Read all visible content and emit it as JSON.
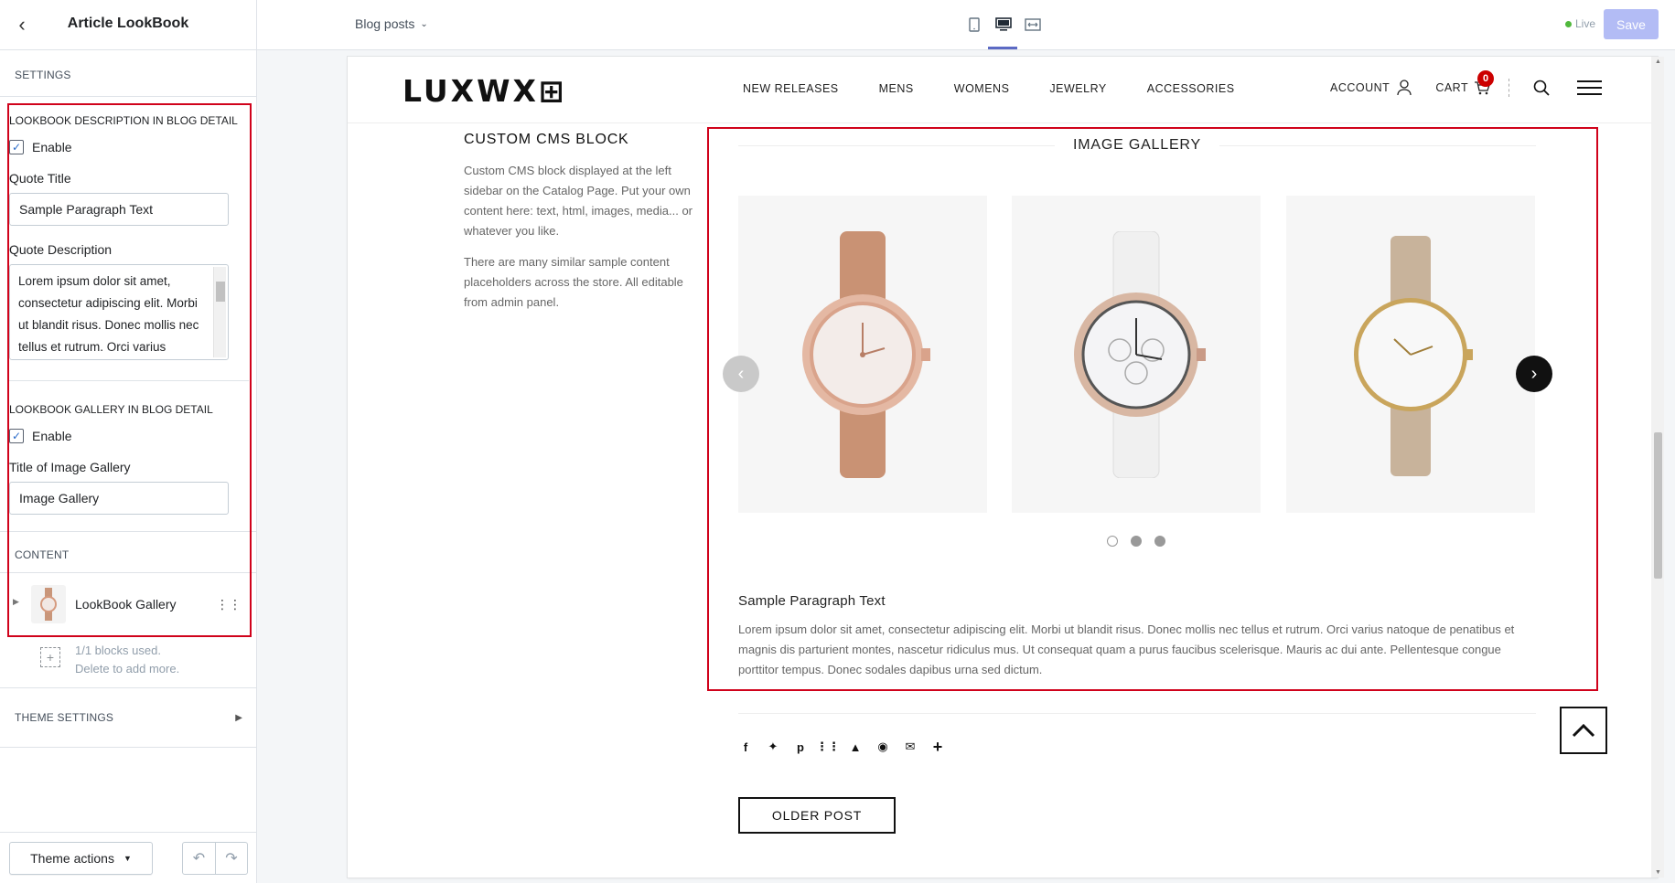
{
  "sidebar": {
    "title": "Article LookBook",
    "settings_label": "SETTINGS",
    "description_group": {
      "title": "LOOKBOOK DESCRIPTION IN BLOG DETAIL",
      "enable_label": "Enable",
      "quote_title_label": "Quote Title",
      "quote_title_value": "Sample Paragraph Text",
      "quote_description_label": "Quote Description",
      "quote_description_value": "Lorem ipsum dolor sit amet, consectetur adipiscing elit. Morbi ut blandit risus. Donec mollis nec tellus et rutrum. Orci varius"
    },
    "gallery_group": {
      "title": "LOOKBOOK GALLERY IN BLOG DETAIL",
      "enable_label": "Enable",
      "gallery_title_label": "Title of Image Gallery",
      "gallery_title_value": "Image Gallery"
    },
    "content_label": "CONTENT",
    "content_block_label": "LookBook Gallery",
    "blocks_used_line1": "1/1 blocks used.",
    "blocks_used_line2": "Delete to add more.",
    "theme_settings_label": "THEME SETTINGS",
    "theme_actions_label": "Theme actions"
  },
  "topbar": {
    "page_select": "Blog posts",
    "live_label": "Live",
    "save_label": "Save"
  },
  "store": {
    "logo": "LUXWX⊞",
    "nav": [
      "NEW RELEASES",
      "MENS",
      "WOMENS",
      "JEWELRY",
      "ACCESSORIES"
    ],
    "account_label": "ACCOUNT",
    "cart_label": "CART",
    "cart_count": "0",
    "cms_title": "CUSTOM CMS BLOCK",
    "cms_text_1": "Custom CMS block displayed at the left sidebar on the Catalog Page. Put your own content here: text, html, images, media... or whatever you like.",
    "cms_text_2": "There are many similar sample content placeholders across the store. All editable from admin panel.",
    "gallery_title": "IMAGE GALLERY",
    "paragraph_title": "Sample Paragraph Text",
    "paragraph_text": "Lorem ipsum dolor sit amet, consectetur adipiscing elit. Morbi ut blandit risus. Donec mollis nec tellus et rutrum. Orci varius natoque de penatibus et magnis dis parturient montes, nascetur ridiculus mus. Ut consequat quam a purus faucibus scelerisque. Mauris ac dui ante. Pellentesque congue porttitor tempus. Donec sodales dapibus urna sed dictum.",
    "older_post_label": "OLDER POST"
  },
  "colors": {
    "highlight_border": "#d0021b",
    "cart_badge": "#cc0000",
    "save_disabled": "#b3bcf5",
    "live_dot": "#50b83c"
  }
}
